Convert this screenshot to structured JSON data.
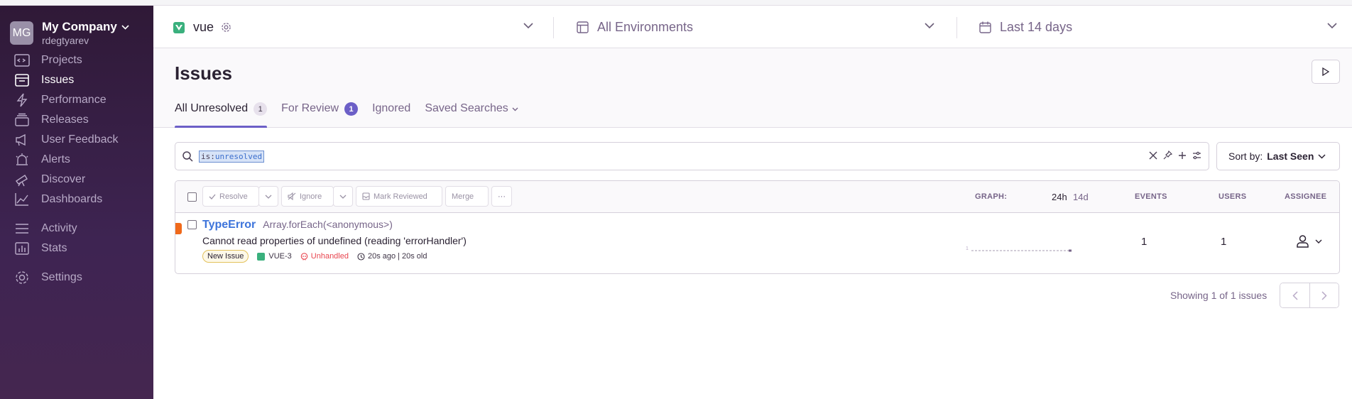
{
  "org": {
    "initials": "MG",
    "name": "My Company",
    "user": "rdegtyarev"
  },
  "sidebar": {
    "items": [
      {
        "label": "Projects",
        "icon": "projects-icon"
      },
      {
        "label": "Issues",
        "icon": "issues-icon",
        "active": true
      },
      {
        "label": "Performance",
        "icon": "lightning-icon"
      },
      {
        "label": "Releases",
        "icon": "releases-icon"
      },
      {
        "label": "User Feedback",
        "icon": "megaphone-icon"
      },
      {
        "label": "Alerts",
        "icon": "siren-icon"
      },
      {
        "label": "Discover",
        "icon": "telescope-icon"
      },
      {
        "label": "Dashboards",
        "icon": "graph-icon"
      },
      {
        "label": "Activity",
        "icon": "list-icon"
      },
      {
        "label": "Stats",
        "icon": "bar-chart-icon"
      },
      {
        "label": "Settings",
        "icon": "gear-icon"
      }
    ]
  },
  "header": {
    "project": "vue",
    "environment": "All Environments",
    "date_range": "Last 14 days"
  },
  "page": {
    "title": "Issues",
    "tabs": [
      {
        "label": "All Unresolved",
        "count": "1",
        "active": true
      },
      {
        "label": "For Review",
        "count": "1"
      },
      {
        "label": "Ignored"
      },
      {
        "label": "Saved Searches"
      }
    ]
  },
  "search": {
    "key": "is:",
    "value": "unresolved"
  },
  "sort": {
    "label": "Sort by:",
    "value": "Last Seen"
  },
  "toolbar": {
    "resolve": "Resolve",
    "ignore": "Ignore",
    "mark_reviewed": "Mark Reviewed",
    "merge": "Merge",
    "more": "···"
  },
  "columns": {
    "graph": "GRAPH:",
    "period_24h": "24h",
    "period_14d": "14d",
    "events": "EVENTS",
    "users": "USERS",
    "assignee": "ASSIGNEE"
  },
  "issues": [
    {
      "type": "TypeError",
      "location": "Array.forEach(<anonymous>)",
      "message": "Cannot read properties of undefined (reading 'errorHandler')",
      "badge": "New Issue",
      "short_id": "VUE-3",
      "handled": "Unhandled",
      "last_seen": "20s ago",
      "age": "20s old",
      "graph_max": "1",
      "events": "1",
      "users": "1"
    }
  ],
  "pagination": {
    "text": "Showing 1 of 1 issues"
  },
  "colors": {
    "accent": "#6c5fc7",
    "link": "#3d74db",
    "error_level": "#f0691a",
    "vue": "#3ab07d",
    "unhandled": "#e8454f"
  }
}
